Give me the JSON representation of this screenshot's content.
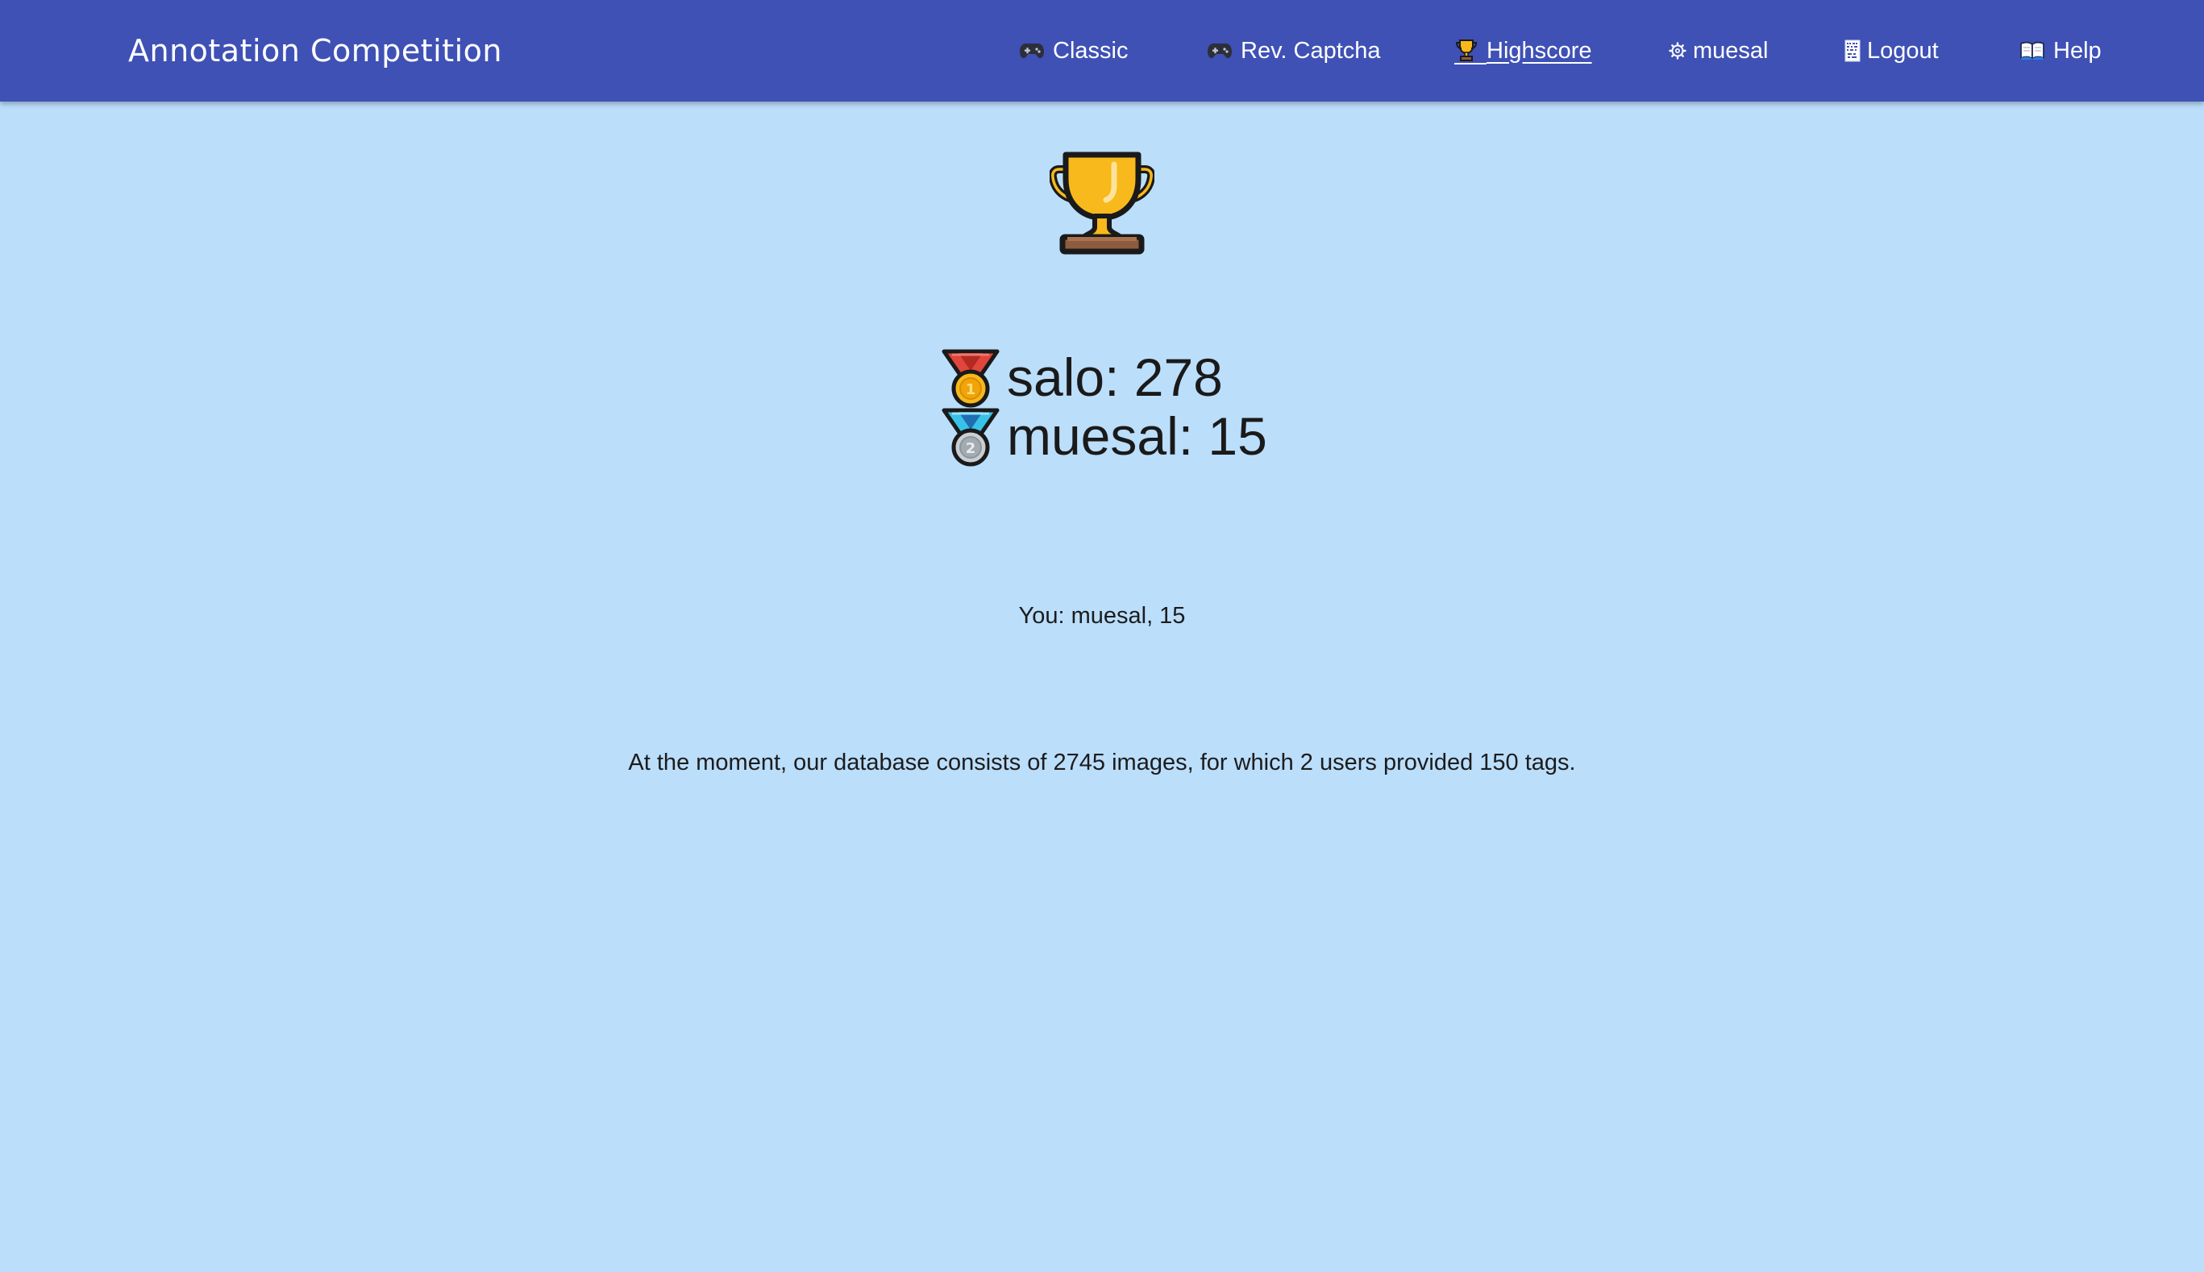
{
  "app": {
    "brand": "Annotation Competition"
  },
  "nav": {
    "items": [
      {
        "label": "Classic",
        "icon": "gamepad-icon"
      },
      {
        "label": "Rev. Captcha",
        "icon": "gamepad-icon"
      },
      {
        "label": "Highscore",
        "icon": "trophy-icon",
        "active": true
      },
      {
        "label": "muesal",
        "icon": "gear-icon"
      },
      {
        "label": "Logout",
        "icon": "logout-icon"
      },
      {
        "label": "Help",
        "icon": "book-icon"
      }
    ]
  },
  "highscore": {
    "header_icon": "trophy-icon",
    "entries": [
      {
        "text": "salo: 278",
        "medal": "gold-medal-icon",
        "medal_number": "1"
      },
      {
        "text": "muesal: 15",
        "medal": "silver-medal-icon",
        "medal_number": "2"
      }
    ],
    "you": "You: muesal, 15"
  },
  "stats": {
    "text": "At the moment, our database consists of 2745 images, for which 2 users provided 150 tags."
  },
  "colors": {
    "navbar": "#3f51b5",
    "background": "#bbdefb",
    "trophy_gold": "#f7b91b",
    "trophy_base": "#8d5b3e",
    "medal_gold_ribbon": "#e2453b",
    "medal_silver_ribbon": "#39c2e8"
  }
}
